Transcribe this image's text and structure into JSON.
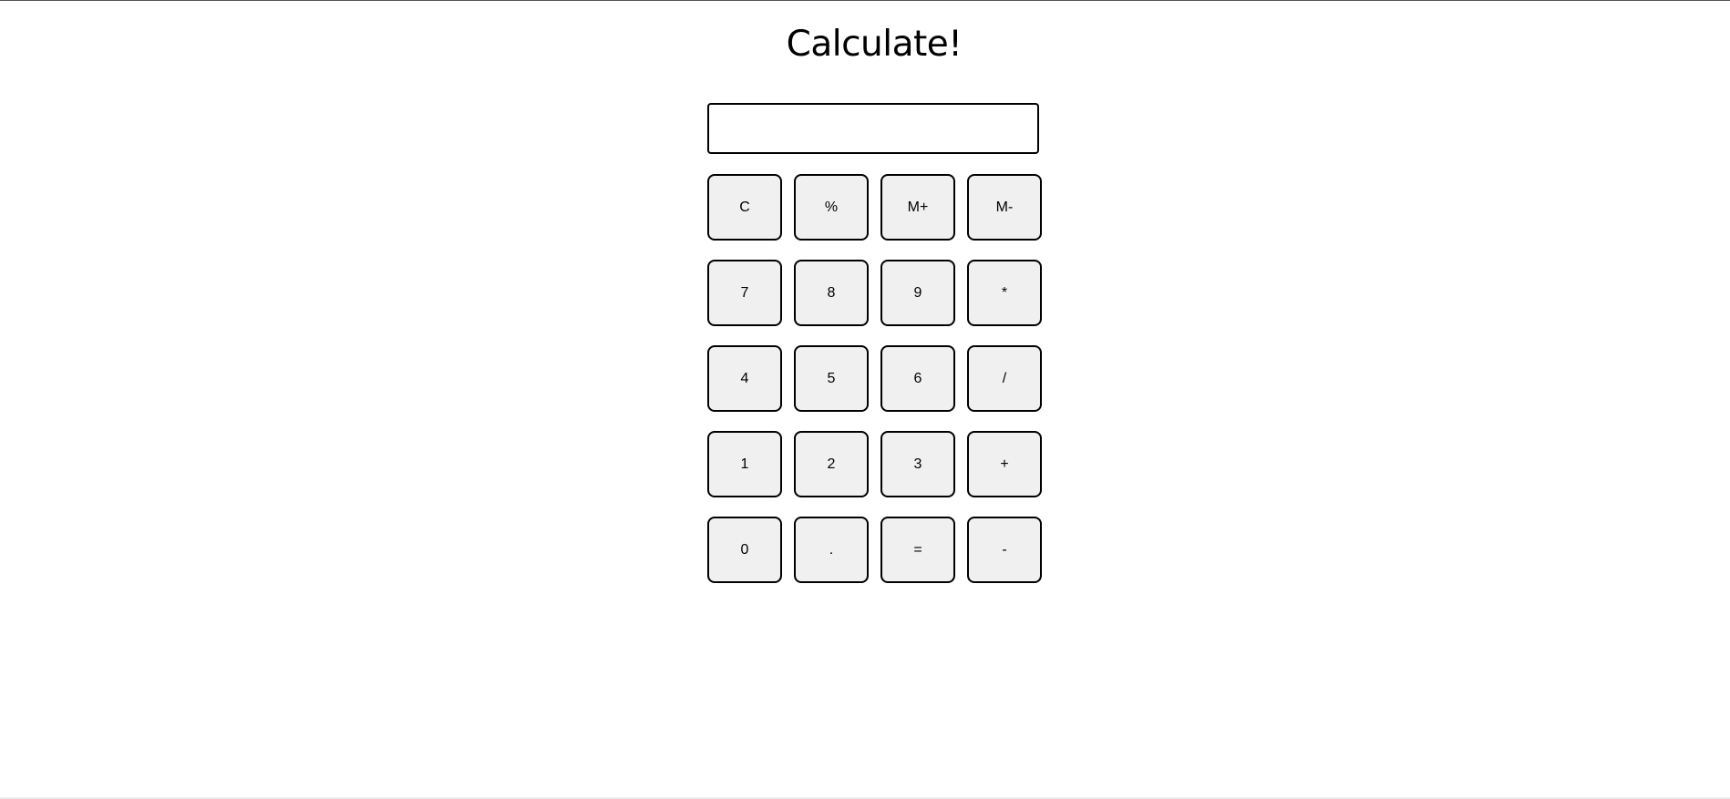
{
  "page": {
    "title": "Calculate!"
  },
  "display": {
    "value": ""
  },
  "keys": [
    [
      "C",
      "%",
      "M+",
      "M-"
    ],
    [
      "7",
      "8",
      "9",
      "*"
    ],
    [
      "4",
      "5",
      "6",
      "/"
    ],
    [
      "1",
      "2",
      "3",
      "+"
    ],
    [
      "0",
      ".",
      "=",
      "-"
    ]
  ],
  "colors": {
    "key_background": "#f0f0f0",
    "border": "#000000",
    "page_background": "#ffffff"
  }
}
